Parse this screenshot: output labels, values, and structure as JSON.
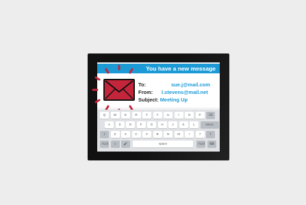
{
  "header": {
    "title": "You have a new message"
  },
  "message": {
    "to_label": "To:",
    "to_value": "sue.j@mail.com",
    "from_label": "From:",
    "from_value": "l.stevens@mail.net",
    "subject_label": "Subject:",
    "subject_value": "Meeting Up"
  },
  "keyboard": {
    "row1": [
      "Q",
      "W",
      "E",
      "R",
      "T",
      "Y",
      "U",
      "I",
      "O",
      "P",
      "⌫"
    ],
    "row2": [
      "A",
      "S",
      "D",
      "F",
      "G",
      "H",
      "J",
      "K",
      "L",
      "return"
    ],
    "row3": [
      "⇧",
      "Z",
      "X",
      "C",
      "V",
      "B",
      "N",
      "M",
      "!",
      "?",
      "⇧"
    ],
    "row4_left": [
      ".?123",
      "☺",
      "🎤"
    ],
    "space": "space",
    "row4_right": [
      ".?123",
      "⌨"
    ]
  },
  "colors": {
    "accent": "#1b9ad6",
    "envelope": "#c5253a",
    "device": "#111111"
  }
}
